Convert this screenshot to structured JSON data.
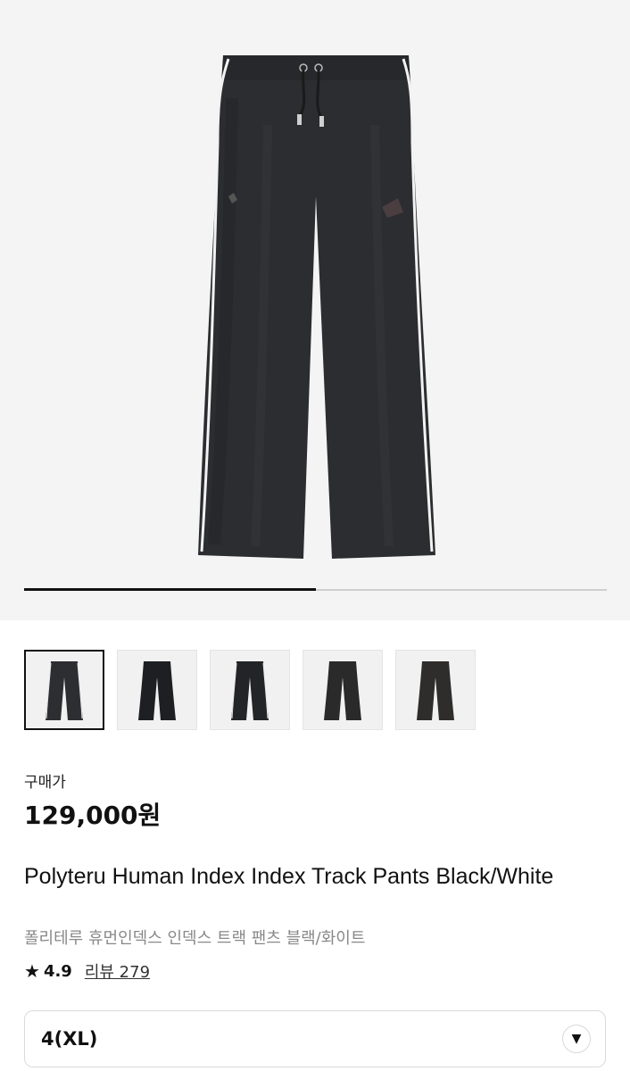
{
  "gallery": {
    "progress_fraction": 0.5,
    "thumbnails": [
      {
        "alt": "pants-front",
        "selected": true,
        "tone": "#2c2e31"
      },
      {
        "alt": "pants-model-1",
        "selected": false,
        "tone": "#1d1f22"
      },
      {
        "alt": "pants-model-2",
        "selected": false,
        "tone": "#222427"
      },
      {
        "alt": "pants-alt-1",
        "selected": false,
        "tone": "#2a2a2a"
      },
      {
        "alt": "pants-alt-2",
        "selected": false,
        "tone": "#2f2d2b"
      }
    ]
  },
  "price": {
    "label": "구매가",
    "value": "129,000원"
  },
  "product": {
    "title": "Polyteru Human Index Index Track Pants Black/White",
    "subtitle": "폴리테루 휴먼인덱스 인덱스 트랙 팬츠 블랙/화이트"
  },
  "rating": {
    "star_icon": "★",
    "score": "4.9",
    "reviews": "리뷰 279"
  },
  "size": {
    "selected": "4(XL)",
    "chevron": "▼"
  },
  "colors": {
    "hero_bg": "#f4f4f4",
    "pants": "#2b2d30",
    "piping": "#f2f2f2"
  }
}
